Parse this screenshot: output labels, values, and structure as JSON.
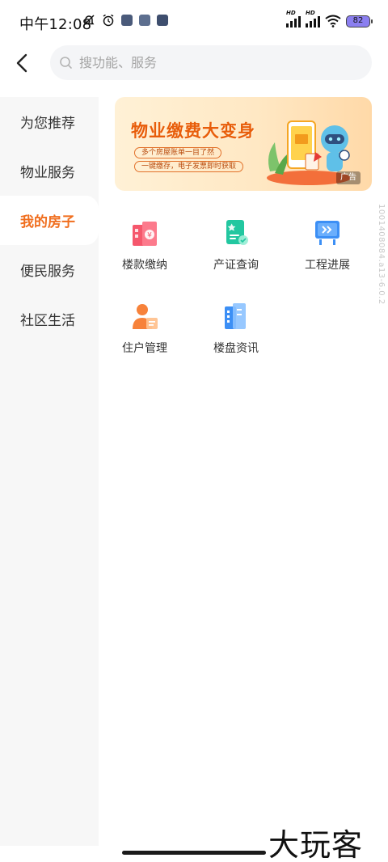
{
  "status_bar": {
    "time": "中午12:08",
    "battery": "82",
    "hd1": "HD",
    "hd2": "HD"
  },
  "header": {
    "back_icon": "chevron-left-icon",
    "search_placeholder": "搜功能、服务"
  },
  "sidebar": {
    "items": [
      {
        "label": "为您推荐"
      },
      {
        "label": "物业服务"
      },
      {
        "label": "我的房子"
      },
      {
        "label": "便民服务"
      },
      {
        "label": "社区生活"
      }
    ],
    "active_index": 2,
    "active_color": "#f06e1e"
  },
  "banner": {
    "title": "物业缴费大变身",
    "line1": "多个房屋账单一目了然",
    "line2": "一键缴存，电子发票即时获取",
    "ad_label": "广告"
  },
  "services": [
    {
      "label": "楼款缴纳",
      "icon": "building-payment-icon",
      "color": "#f5576c"
    },
    {
      "label": "产证查询",
      "icon": "certificate-search-icon",
      "color": "#22c7a0"
    },
    {
      "label": "工程进展",
      "icon": "progress-board-icon",
      "color": "#3c8ff5"
    },
    {
      "label": "住户管理",
      "icon": "resident-icon",
      "color": "#f7823a"
    },
    {
      "label": "楼盘资讯",
      "icon": "building-info-icon",
      "color": "#3c8ff5"
    }
  ],
  "side_watermark": "1001408084.a13-6.0.2",
  "logo_text": "大玩客"
}
